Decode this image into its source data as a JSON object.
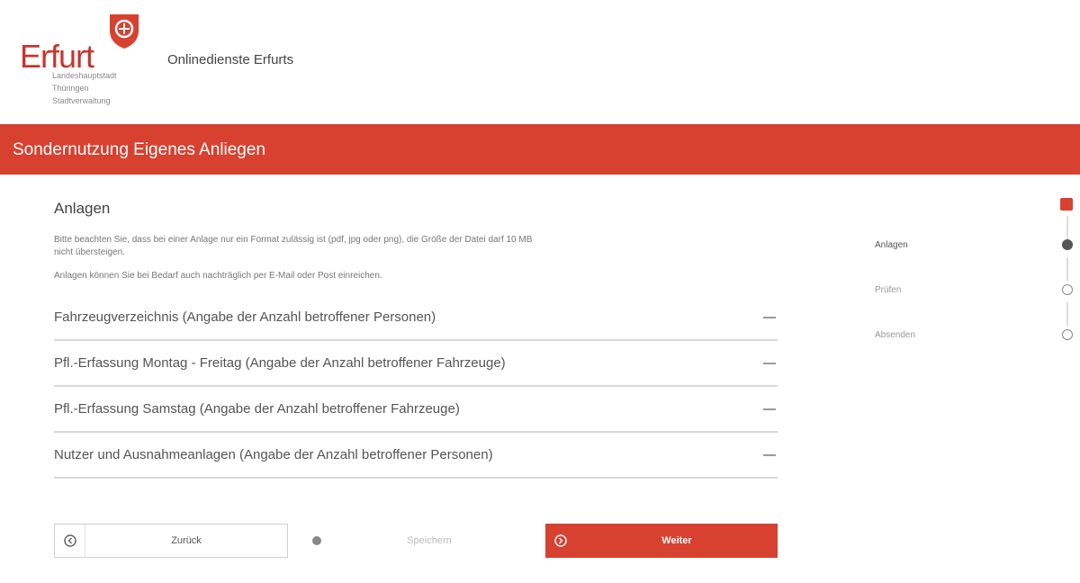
{
  "header": {
    "logo_word": "Erfurt",
    "logo_sub_1": "Landeshauptstadt",
    "logo_sub_2": "Thüringen",
    "logo_sub_3": "Stadtverwaltung",
    "site_name": "Onlinedienste Erfurts"
  },
  "banner": {
    "title": "Sondernutzung Eigenes Anliegen"
  },
  "main": {
    "section_title": "Anlagen",
    "desc_1": "Bitte beachten Sie, dass bei einer Anlage nur ein Format zulässig ist (pdf, jpg oder png), die Größe der Datei darf 10 MB nicht übersteigen.",
    "desc_2": "Anlagen können Sie bei Bedarf auch nachträglich per E-Mail oder Post einreichen.",
    "accordion": [
      {
        "label": "Fahrzeugverzeichnis (Angabe der Anzahl betroffener Personen)"
      },
      {
        "label": "Pfl.-Erfassung Montag - Freitag (Angabe der Anzahl betroffener Fahrzeuge)"
      },
      {
        "label": "Pfl.-Erfassung Samstag (Angabe der Anzahl betroffener Fahrzeuge)"
      },
      {
        "label": "Nutzer und Ausnahmeanlagen (Angabe der Anzahl betroffener Personen)"
      }
    ]
  },
  "buttons": {
    "back": "Zurück",
    "save": "Speichern",
    "next": "Weiter"
  },
  "steps": [
    {
      "label": "Anlagen",
      "state": "current"
    },
    {
      "label": "Prüfen",
      "state": "todo"
    },
    {
      "label": "Absenden",
      "state": "todo"
    }
  ],
  "colors": {
    "accent": "#d8412f",
    "text": "#333333"
  }
}
